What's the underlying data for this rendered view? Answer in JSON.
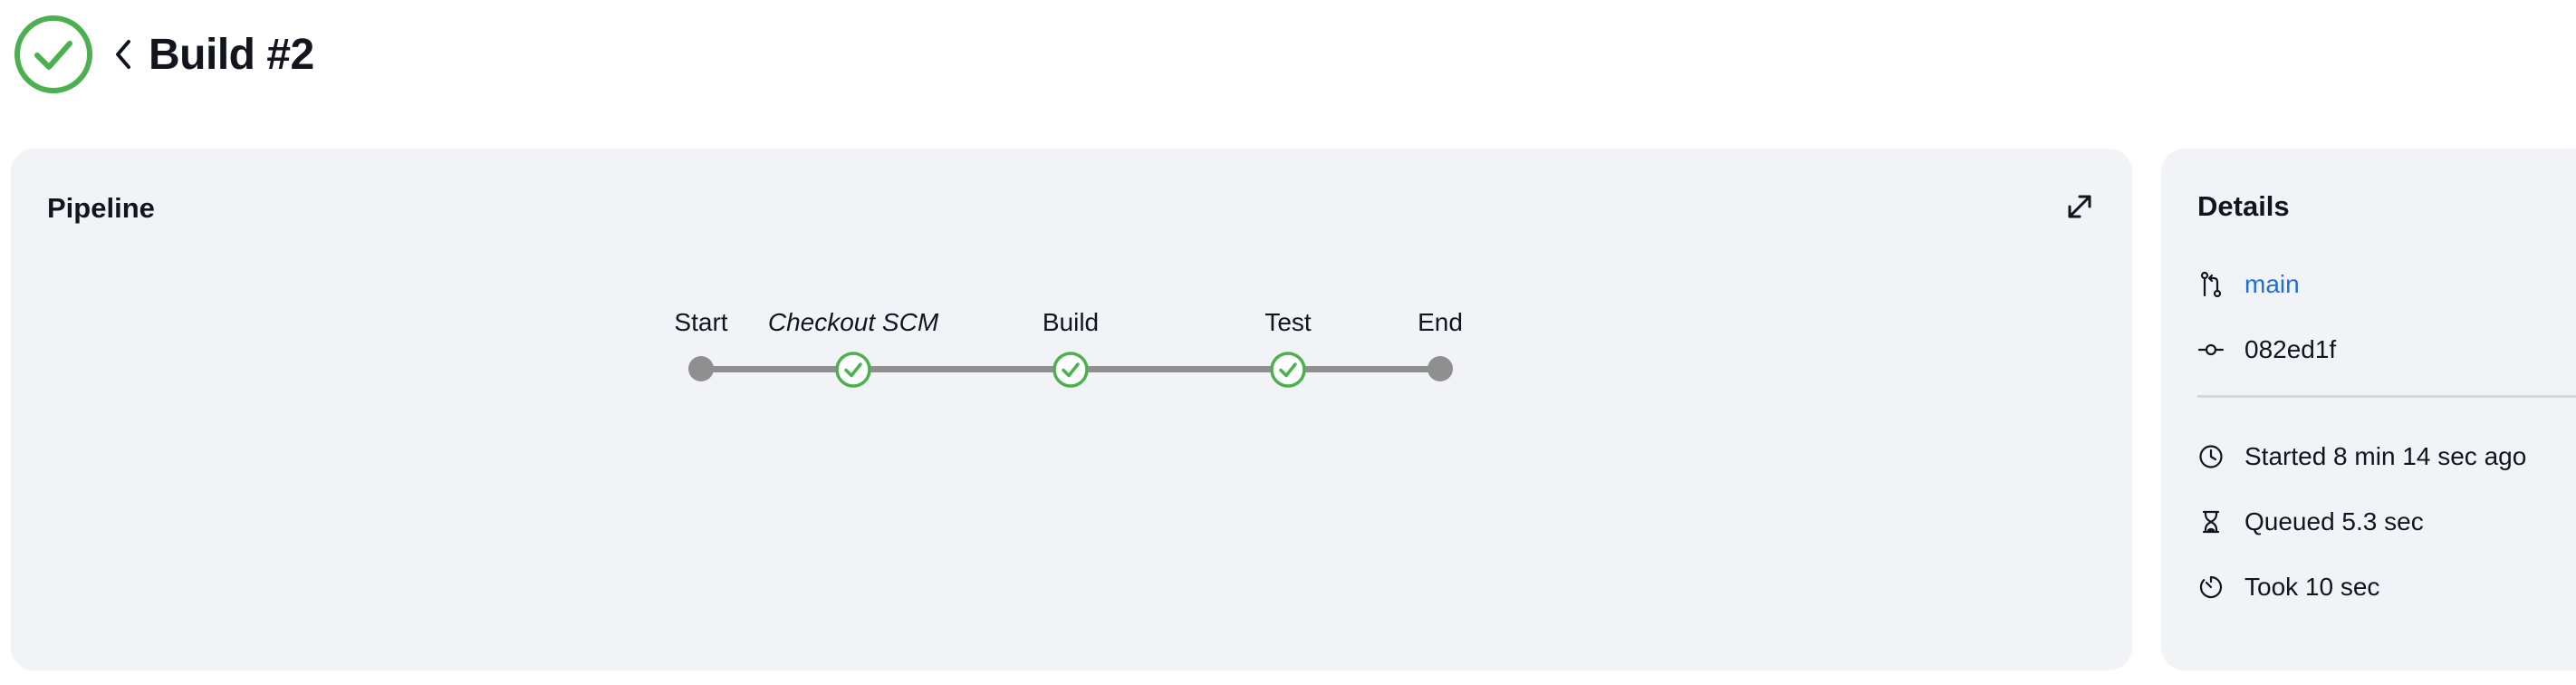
{
  "header": {
    "title": "Build #2",
    "status": "success",
    "status_color": "#4caf50"
  },
  "pipeline": {
    "title": "Pipeline",
    "stages": [
      {
        "label": "Start",
        "type": "endpoint"
      },
      {
        "label": "Checkout SCM",
        "type": "success"
      },
      {
        "label": "Build",
        "type": "success"
      },
      {
        "label": "Test",
        "type": "success"
      },
      {
        "label": "End",
        "type": "endpoint"
      }
    ],
    "track_color": "#8f8f8f"
  },
  "details": {
    "title": "Details",
    "branch": "main",
    "commit": "082ed1f",
    "started": "Started 8 min 14 sec ago",
    "queued": "Queued 5.3 sec",
    "took": "Took 10 sec"
  },
  "icons": {
    "status": "check-circle-icon",
    "back": "chevron-left-icon",
    "expand": "expand-icon",
    "branch": "git-branch-icon",
    "commit": "git-commit-icon",
    "started": "clock-icon",
    "queued": "hourglass-icon",
    "took": "timer-icon"
  },
  "colors": {
    "success": "#4caf50",
    "link": "#1f6fd6",
    "card_bg": "#f2f3f6"
  }
}
